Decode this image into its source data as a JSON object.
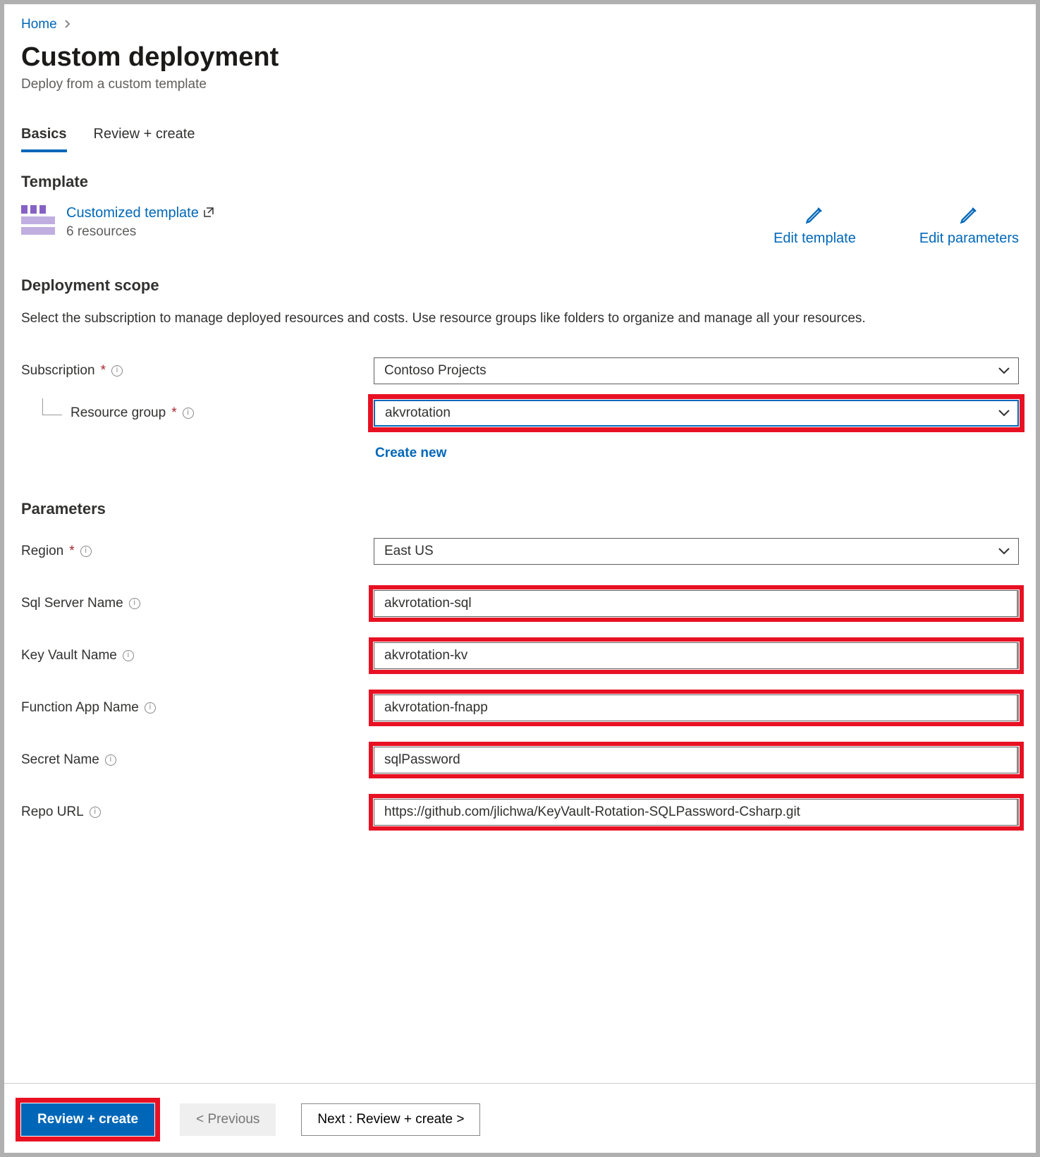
{
  "breadcrumb": {
    "home": "Home"
  },
  "title": "Custom deployment",
  "subtitle": "Deploy from a custom template",
  "tabs": {
    "basics": "Basics",
    "review": "Review + create"
  },
  "sections": {
    "template": "Template",
    "scope": "Deployment scope",
    "parameters": "Parameters"
  },
  "template": {
    "link": "Customized template",
    "resources": "6 resources",
    "edit_template": "Edit template",
    "edit_parameters": "Edit parameters"
  },
  "scope_description": "Select the subscription to manage deployed resources and costs. Use resource groups like folders to organize and manage all your resources.",
  "labels": {
    "subscription": "Subscription",
    "resource_group": "Resource group",
    "create_new": "Create new",
    "region": "Region",
    "sql_server_name": "Sql Server Name",
    "key_vault_name": "Key Vault Name",
    "function_app_name": "Function App Name",
    "secret_name": "Secret Name",
    "repo_url": "Repo URL"
  },
  "values": {
    "subscription": "Contoso Projects",
    "resource_group": "akvrotation",
    "region": "East US",
    "sql_server_name": "akvrotation-sql",
    "key_vault_name": "akvrotation-kv",
    "function_app_name": "akvrotation-fnapp",
    "secret_name": "sqlPassword",
    "repo_url": "https://github.com/jlichwa/KeyVault-Rotation-SQLPassword-Csharp.git"
  },
  "footer": {
    "review_create": "Review + create",
    "previous": "< Previous",
    "next": "Next : Review + create >"
  }
}
